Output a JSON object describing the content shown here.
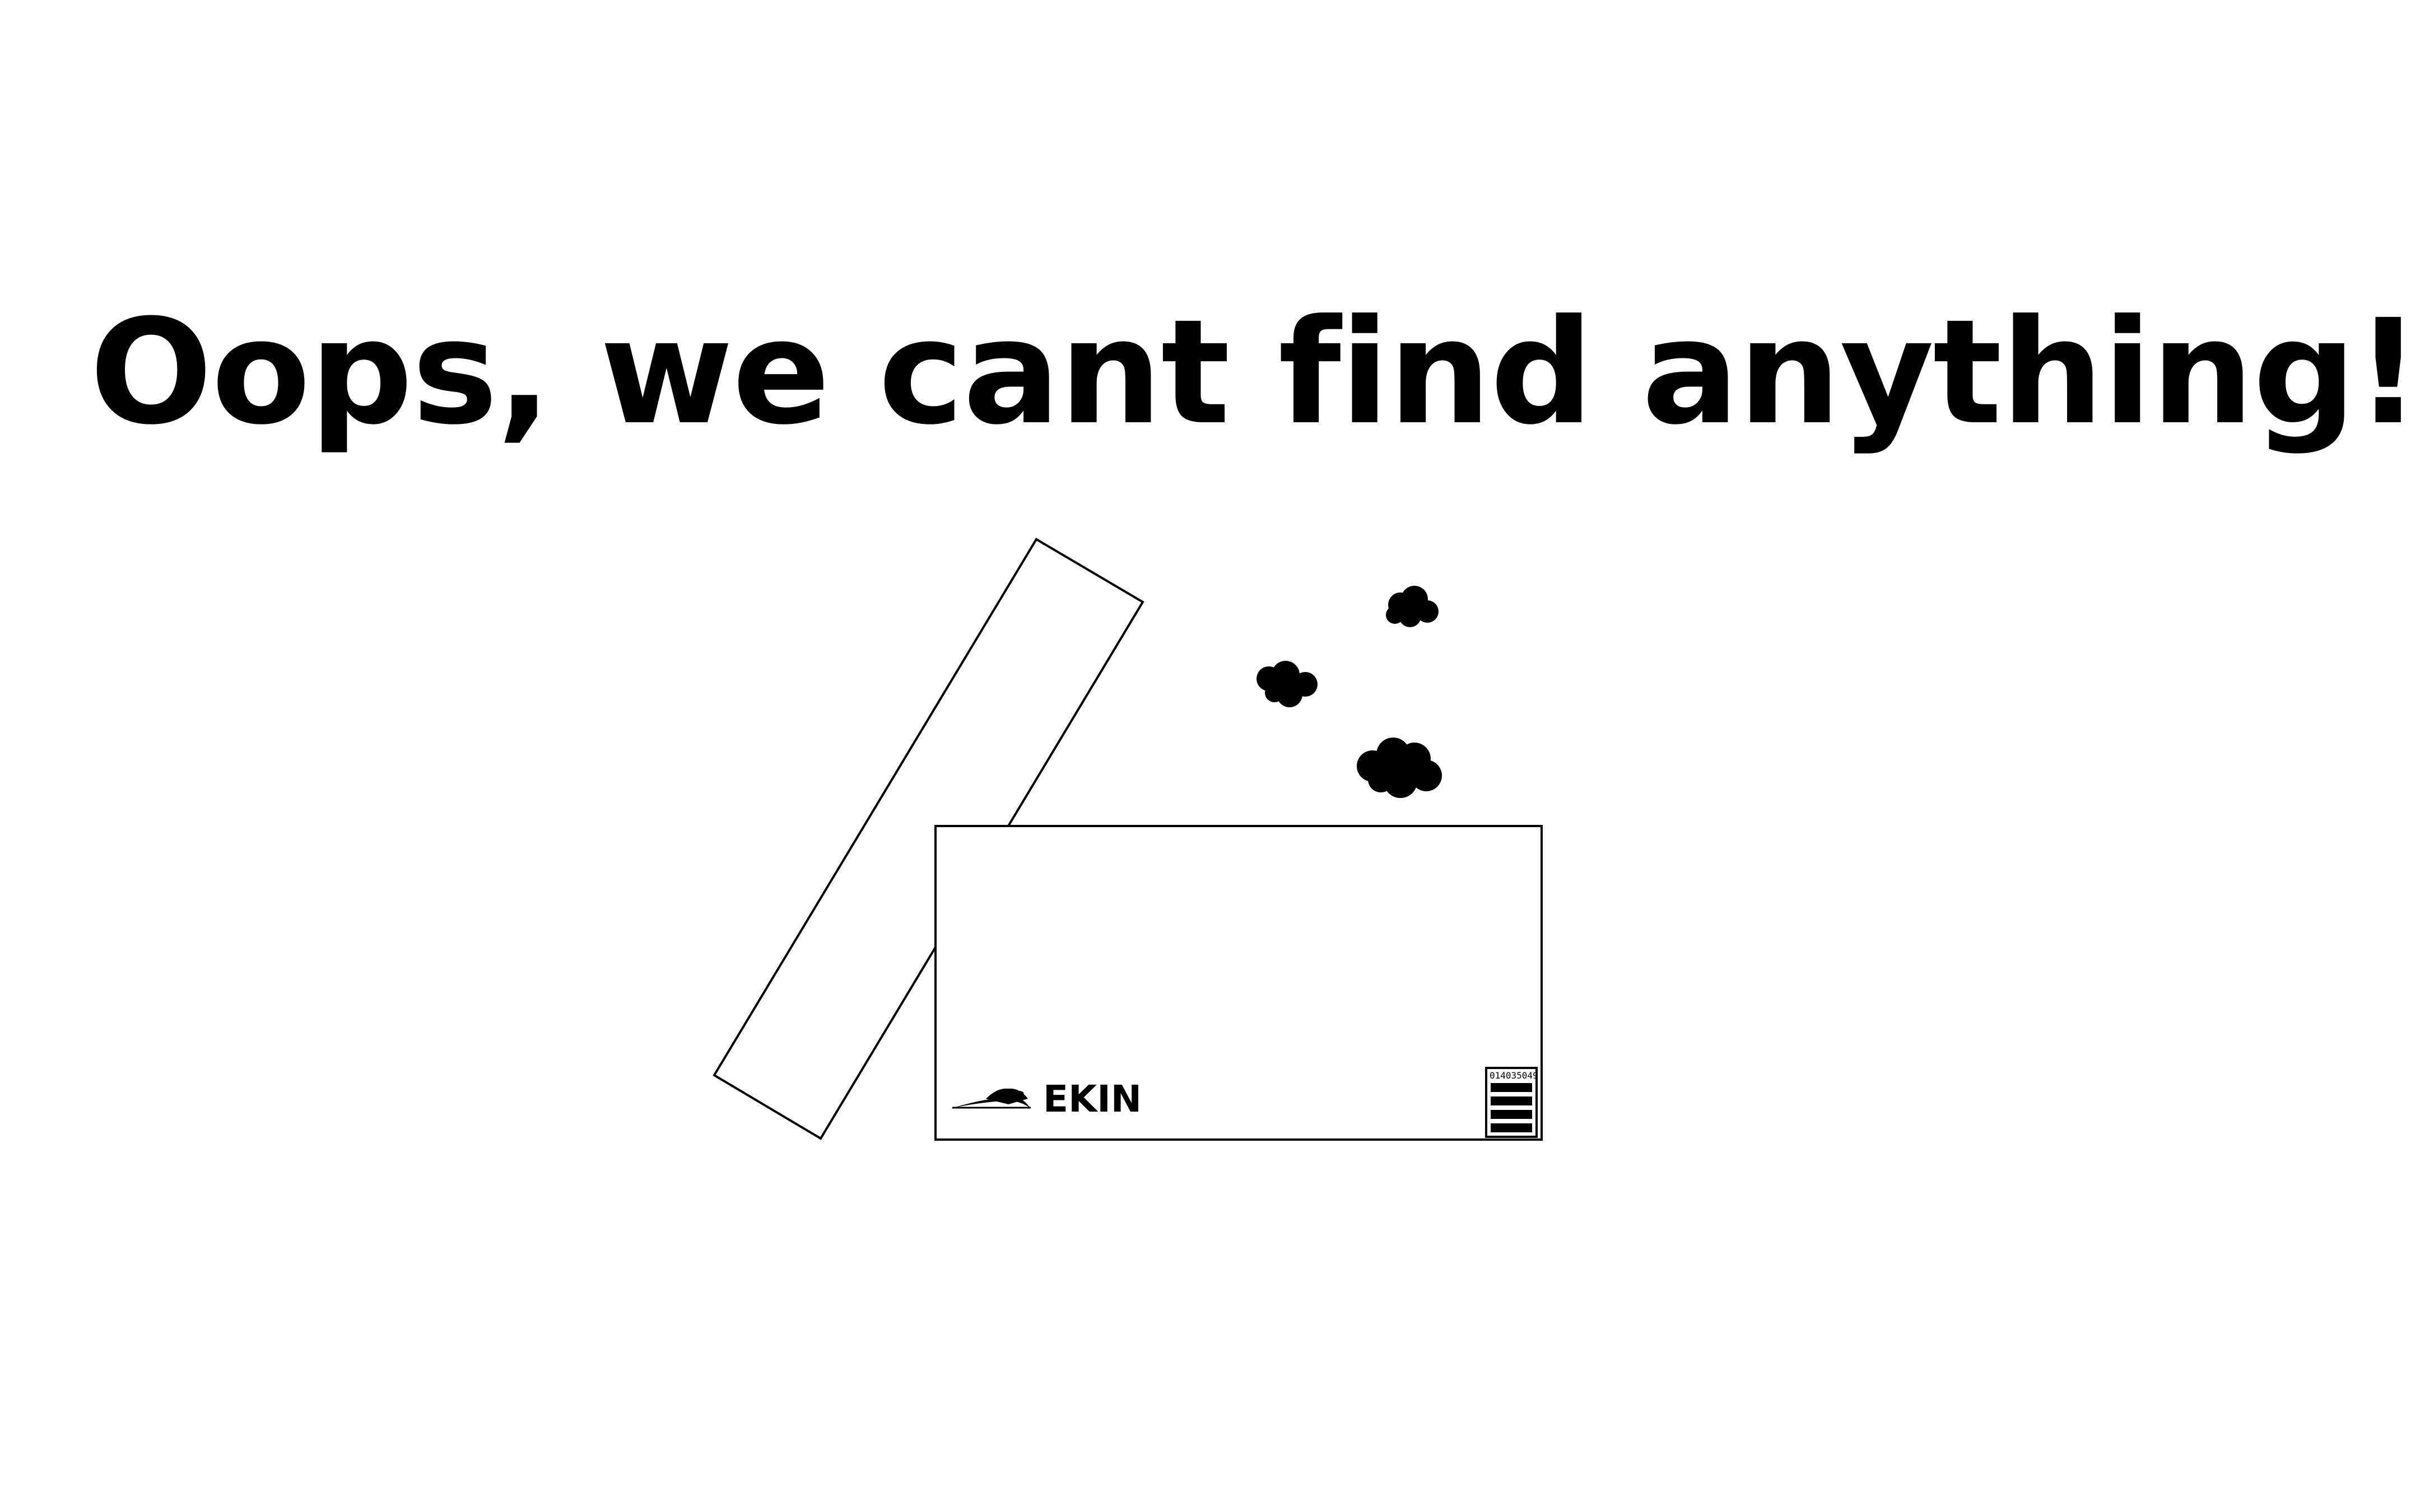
{
  "page": {
    "headline": "Oops, we cant find anything!"
  },
  "box": {
    "brand_name": "EKIN",
    "barcode_number": "014035049"
  },
  "colors": {
    "background": "#ffffff",
    "ink": "#000000"
  },
  "icons": {
    "brand_logo": "swoosh-logo-icon",
    "barcode": "barcode-icon",
    "dust_clouds": [
      "dust-cloud-icon",
      "dust-cloud-icon",
      "dust-cloud-icon"
    ]
  }
}
